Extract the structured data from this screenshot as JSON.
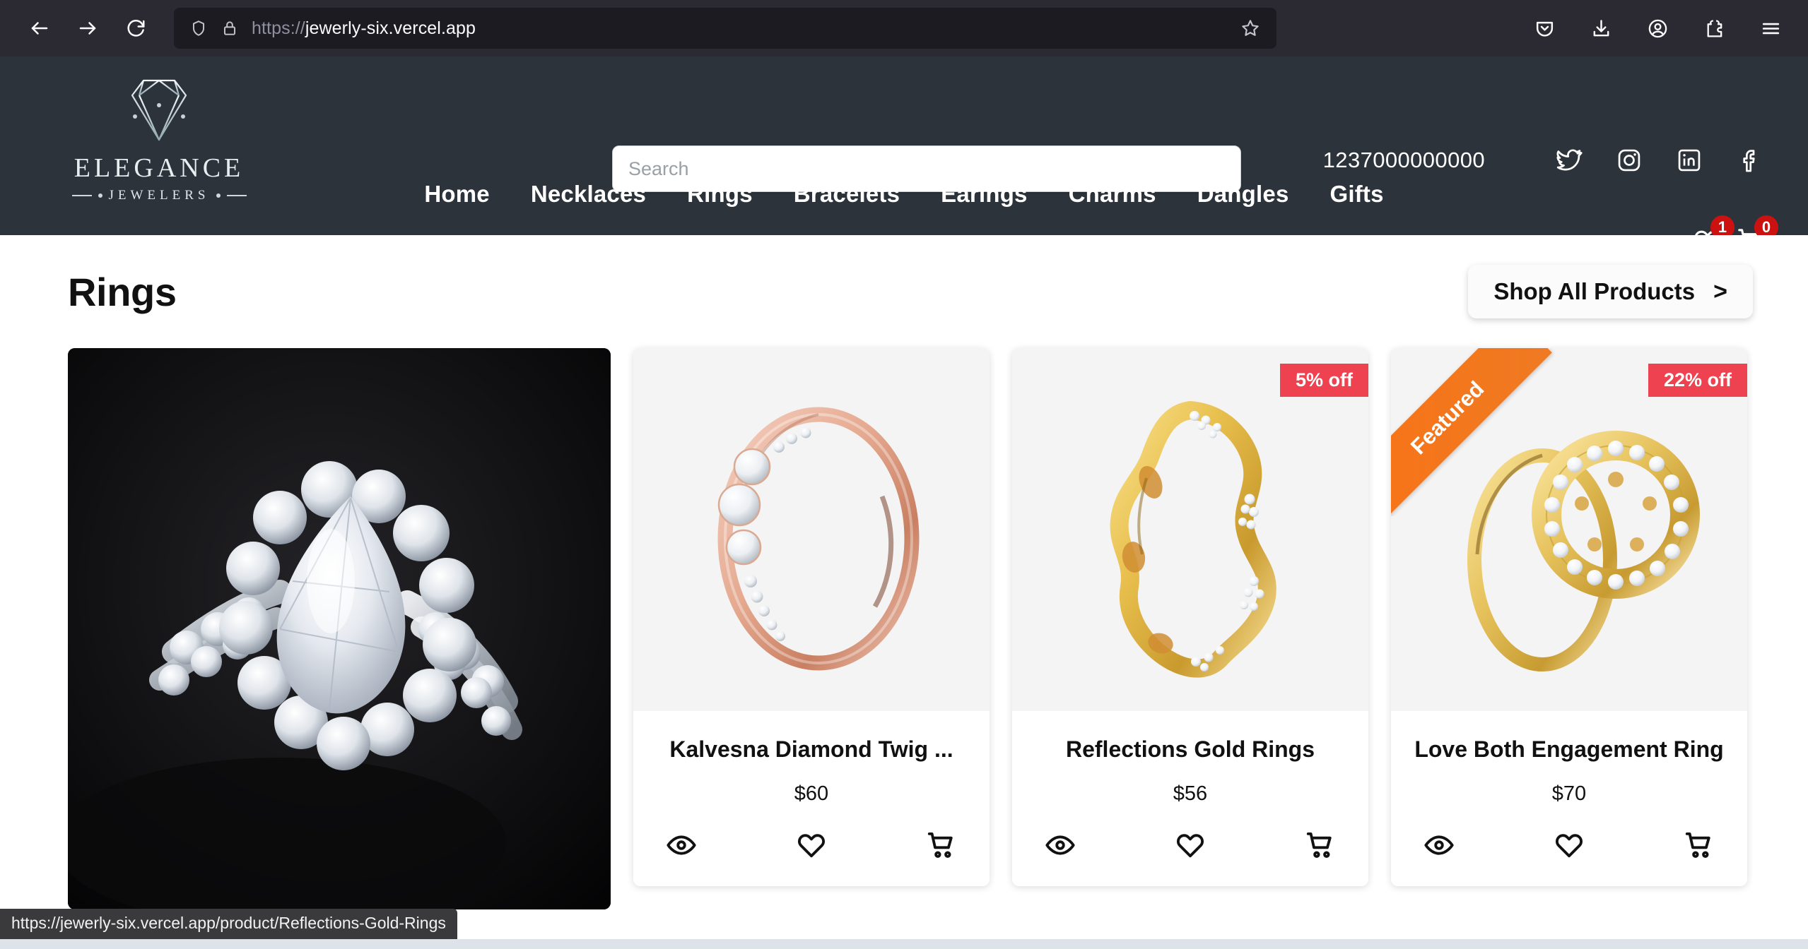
{
  "browser": {
    "url_scheme": "https://",
    "url_rest": "jewerly-six.vercel.app",
    "back_label": "Back",
    "forward_label": "Forward",
    "reload_label": "Reload",
    "shield_icon": "shield-icon",
    "lock_icon": "lock-icon",
    "bookmark_icon": "star-icon",
    "toolbar_icons": [
      "pocket-icon",
      "download-icon",
      "account-icon",
      "extensions-icon",
      "menu-icon"
    ],
    "status_url": "https://jewerly-six.vercel.app/product/Reflections-Gold-Rings"
  },
  "header": {
    "brand": "ELEGANCE",
    "brand_sub": "JEWELERS",
    "logo_icon": "diamond-icon",
    "search": {
      "placeholder": "Search",
      "value": ""
    },
    "phone": "1237000000000",
    "socials": [
      {
        "name": "twitter-icon",
        "label": "Twitter"
      },
      {
        "name": "instagram-icon",
        "label": "Instagram"
      },
      {
        "name": "linkedin-icon",
        "label": "LinkedIn"
      },
      {
        "name": "facebook-icon",
        "label": "Facebook"
      }
    ],
    "nav": [
      {
        "label": "Home"
      },
      {
        "label": "Necklaces"
      },
      {
        "label": "Rings"
      },
      {
        "label": "Bracelets"
      },
      {
        "label": "Earings"
      },
      {
        "label": "Charms"
      },
      {
        "label": "Dangles"
      },
      {
        "label": "Gifts"
      }
    ],
    "wishlist_count": "1",
    "cart_count": "0",
    "bg_color": "#2c333a",
    "badge_color": "#cc1111"
  },
  "main": {
    "page_title": "Rings",
    "shop_all_label": "Shop All Products",
    "shop_all_chevron": ">",
    "hero": {
      "alt": "Pear cut diamond halo engagement ring on black background"
    },
    "products": [
      {
        "name": "Kalvesna Diamond Twig ...",
        "price": "$60",
        "badge": "",
        "featured": "",
        "alt": "Rose gold three stone ring",
        "actions": [
          "eye-icon",
          "heart-icon",
          "cart-icon"
        ]
      },
      {
        "name": "Reflections Gold Rings",
        "price": "$56",
        "badge": "5% off",
        "featured": "",
        "alt": "Gold wavy band ring with pave stones",
        "actions": [
          "eye-icon",
          "heart-icon",
          "cart-icon"
        ]
      },
      {
        "name": "Love Both Engagement Ring",
        "price": "$70",
        "badge": "22% off",
        "featured": "Featured",
        "alt": "Gold ring with pave circle motif",
        "actions": [
          "eye-icon",
          "heart-icon",
          "cart-icon"
        ]
      }
    ],
    "discount_color": "#ef4250",
    "featured_color": "#f97316"
  }
}
